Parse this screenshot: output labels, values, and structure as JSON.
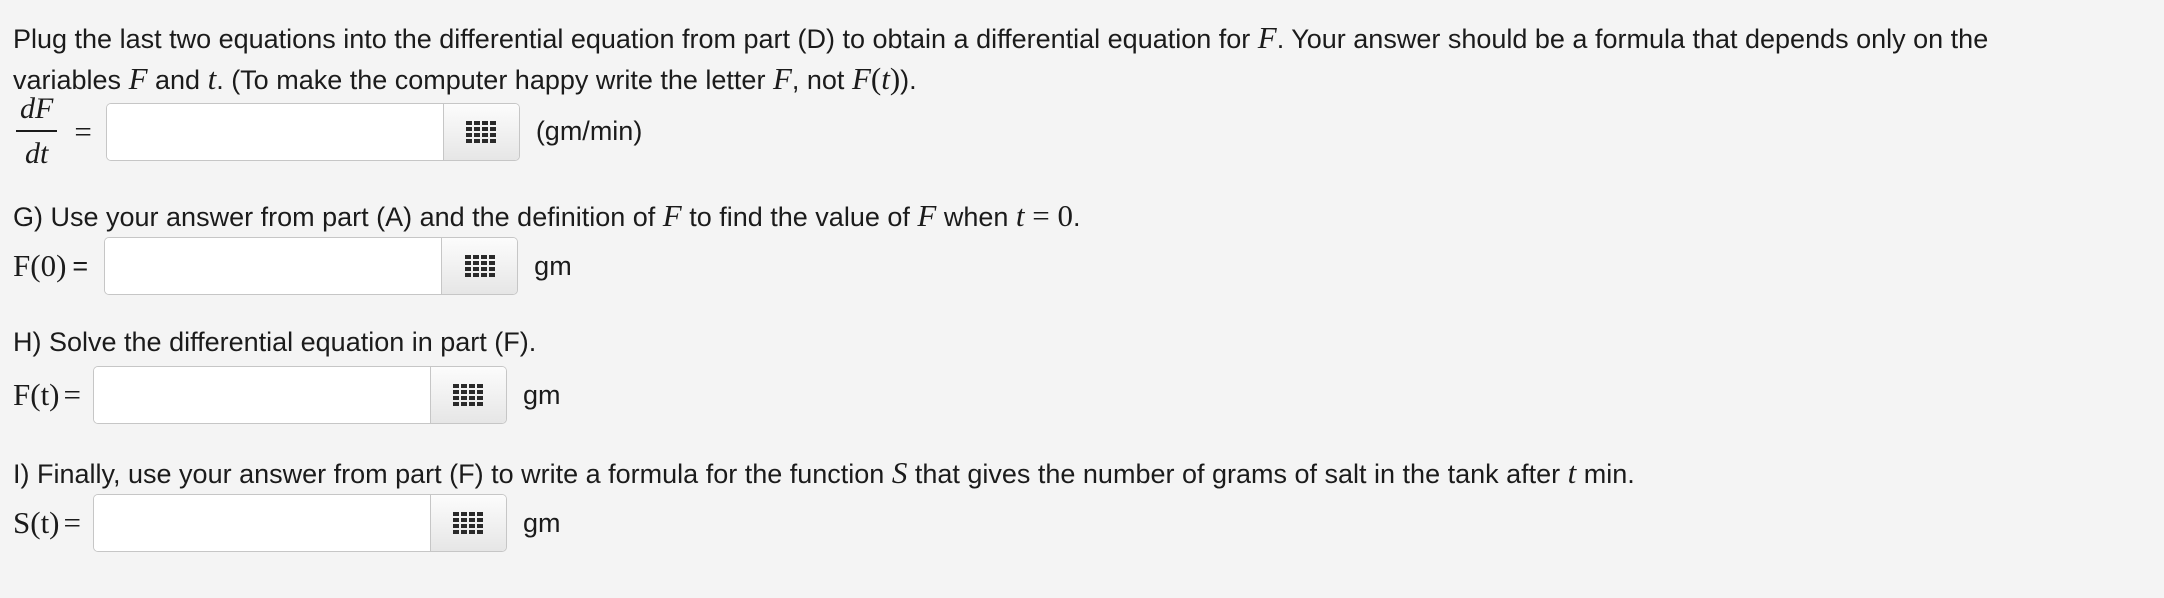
{
  "intro": {
    "t1": "Plug the last two equations into the differential equation from part (D) to obtain a differential equation for ",
    "v1": "F",
    "t2": ". Your answer should be a formula that depends only on the",
    "t3": "variables ",
    "v2": "F",
    "t4": " and ",
    "v3": "t",
    "t5": ". (To make the computer happy write the letter ",
    "v4": "F",
    "t6": ", not ",
    "v5": "F",
    "v6": "(",
    "v7": "t",
    "v8": ")",
    "t7": ")."
  },
  "rowF": {
    "num": "dF",
    "den": "dt",
    "eq": "=",
    "unit": "(gm/min)",
    "value": ""
  },
  "partG": {
    "t1": "G) Use your answer from part (A) and the definition of ",
    "v1": "F",
    "t2": " to find the value of ",
    "v2": "F",
    "t3": " when ",
    "v3": "t",
    "v4": " = 0",
    "t4": ".",
    "lhs": "F(0)",
    "eq": " =",
    "unit": "gm",
    "value": ""
  },
  "partH": {
    "t1": "H) Solve the differential equation in part (F).",
    "lhs": "F(t)",
    "eq": " =",
    "unit": "gm",
    "value": ""
  },
  "partI": {
    "t1": "I) Finally, use your answer from part (F) to write a formula for the function ",
    "v1": "S",
    "t2": " that gives the number of grams of salt in the tank after ",
    "v2": "t",
    "t3": " min.",
    "lhs": "S(t)",
    "eq": " =",
    "unit": "gm",
    "value": ""
  },
  "icons": {
    "palette": "grid-palette-icon"
  },
  "colors": {
    "background": "#f4f4f4",
    "text": "#1b1b1b",
    "input_border": "#c6c6c6",
    "icon": "#2a2a2a"
  }
}
